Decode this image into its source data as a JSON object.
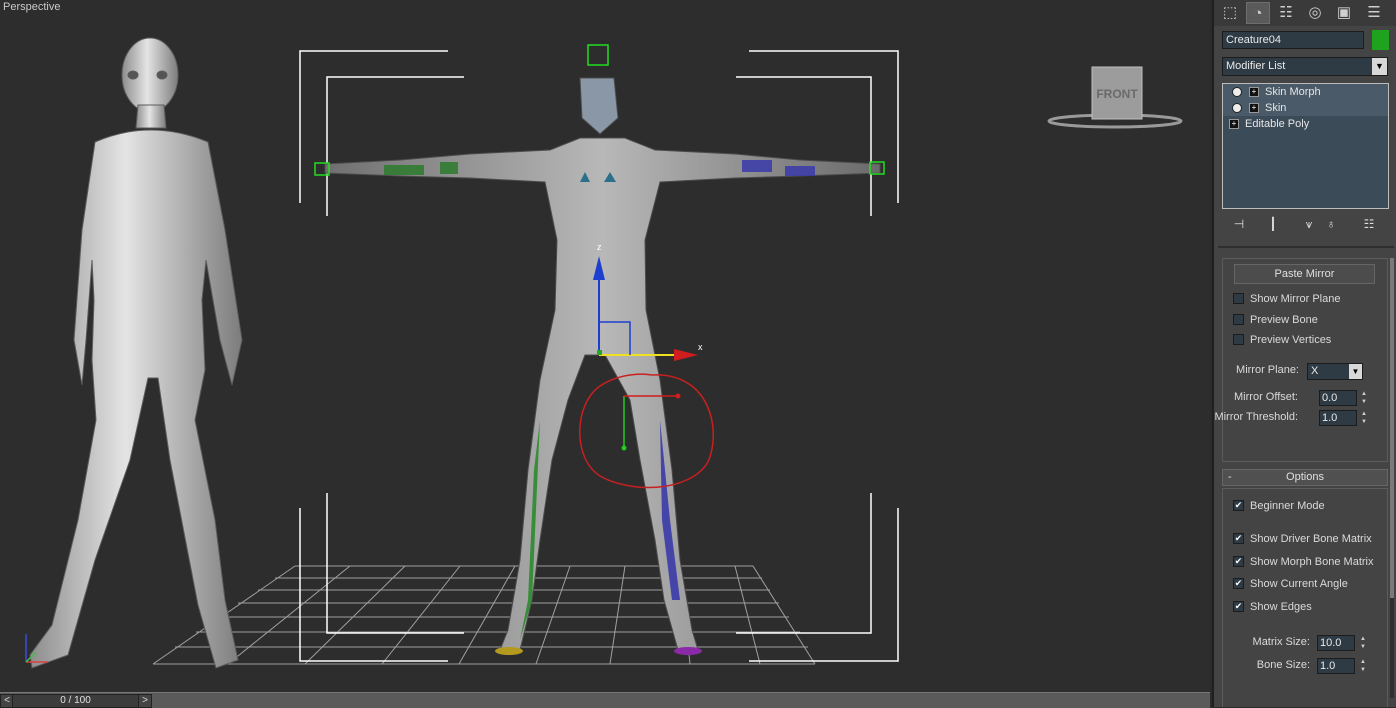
{
  "viewport": {
    "label": "Perspective",
    "viewcube_label": "FRONT",
    "gizmo_x": "x",
    "gizmo_z": "z"
  },
  "timeline": {
    "frame_readout": "0 / 100",
    "prev_arrow": "<",
    "next_arrow": ">"
  },
  "panel": {
    "tabs": [
      {
        "icon": "create-icon",
        "glyph": "⬚"
      },
      {
        "icon": "modify-icon",
        "glyph": "◔"
      },
      {
        "icon": "hierarchy-icon",
        "glyph": "☷"
      },
      {
        "icon": "motion-icon",
        "glyph": "◎"
      },
      {
        "icon": "display-icon",
        "glyph": "▣"
      },
      {
        "icon": "utilities-icon",
        "glyph": "☰"
      }
    ],
    "object_name": "Creature04",
    "object_color": "#1fa31f",
    "modifier_list": "Modifier List",
    "stack": [
      {
        "label": "Skin Morph",
        "sub": true
      },
      {
        "label": "Skin",
        "sub": true
      },
      {
        "label": "Editable Poly",
        "sub": false
      }
    ],
    "stack_tools": [
      {
        "icon": "pin-stack-icon",
        "glyph": "⊣"
      },
      {
        "icon": "show-end-result-icon",
        "glyph": "┃"
      },
      {
        "icon": "make-unique-icon",
        "glyph": "⩛"
      },
      {
        "icon": "remove-modifier-icon",
        "glyph": "♁"
      },
      {
        "icon": "configure-modifier-sets-icon",
        "glyph": "☷"
      }
    ],
    "mirror": {
      "paste_mirror": "Paste Mirror",
      "show_mirror_plane": "Show Mirror Plane",
      "preview_bone": "Preview Bone",
      "preview_vertices": "Preview Vertices",
      "mirror_plane_label": "Mirror Plane:",
      "mirror_plane_value": "X",
      "mirror_offset_label": "Mirror Offset:",
      "mirror_offset_value": "0.0",
      "mirror_threshold_label": "Mirror Threshold:",
      "mirror_threshold_value": "1.0"
    },
    "options": {
      "header": "Options",
      "collapse": "-",
      "beginner_mode": "Beginner Mode",
      "show_driver_bone_matrix": "Show Driver Bone Matrix",
      "show_morph_bone_matrix": "Show Morph Bone Matrix",
      "show_current_angle": "Show Current Angle",
      "show_edges": "Show Edges",
      "matrix_size_label": "Matrix Size:",
      "matrix_size_value": "10.0",
      "bone_size_label": "Bone Size:",
      "bone_size_value": "1.0"
    },
    "check_glyph": "✔"
  }
}
